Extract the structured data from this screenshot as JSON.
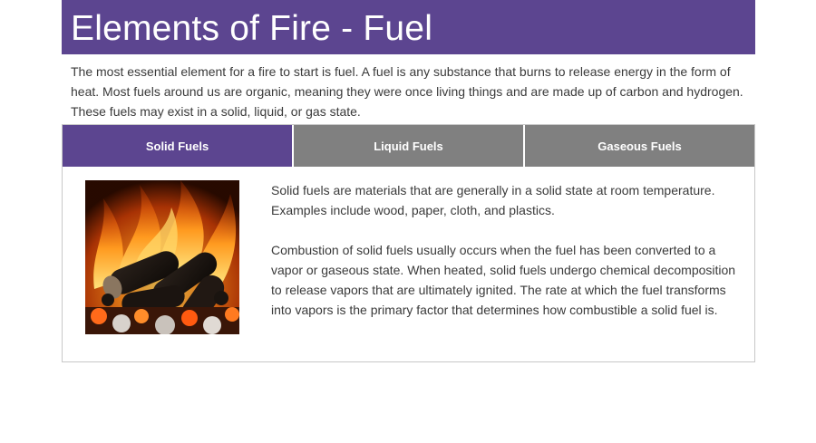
{
  "page": {
    "title": "Elements of Fire - Fuel",
    "intro": "The most essential element for a fire to start is fuel. A fuel is any substance that burns to release energy in the form of heat. Most fuels around us are organic, meaning they were once living things and are made up of carbon and hydrogen. These fuels may exist in a solid, liquid, or gas state."
  },
  "tabs": [
    {
      "label": "Solid Fuels",
      "active": true
    },
    {
      "label": "Liquid Fuels",
      "active": false
    },
    {
      "label": "Gaseous Fuels",
      "active": false
    }
  ],
  "content": {
    "image": "burning-wood-fire-image",
    "paragraph_1": "Solid fuels are materials that are generally in a solid state at room temperature. Examples include wood, paper, cloth, and plastics.",
    "paragraph_2": "Combustion of solid fuels usually occurs when the fuel has been converted to a vapor or gaseous state. When heated, solid fuels undergo chemical decomposition to release vapors that are ultimately ignited. The rate at which the fuel transforms into vapors is the primary factor that determines how combustible a solid fuel is."
  },
  "colors": {
    "header_bg": "#5c4590",
    "tab_active_bg": "#5c4590",
    "tab_inactive_bg": "#808080",
    "text": "#3a3a3a"
  }
}
